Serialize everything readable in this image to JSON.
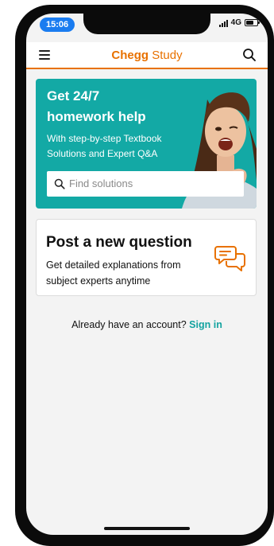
{
  "status_bar": {
    "time": "15:06",
    "network": "4G"
  },
  "app_bar": {
    "logo_brand": "Chegg",
    "logo_product": "Study"
  },
  "hero": {
    "title_line1": "Get 24/7",
    "title_line2": "homework help",
    "subtitle": "With step-by-step Textbook Solutions and Expert Q&A",
    "search_placeholder": "Find solutions"
  },
  "post_card": {
    "title": "Post a new question",
    "description": "Get detailed explanations from subject experts anytime"
  },
  "signin": {
    "prompt": "Already have an account?",
    "link": "Sign in"
  },
  "colors": {
    "accent_orange": "#e87100",
    "hero_teal": "#13a9a5",
    "status_blue": "#1a7cf0"
  }
}
